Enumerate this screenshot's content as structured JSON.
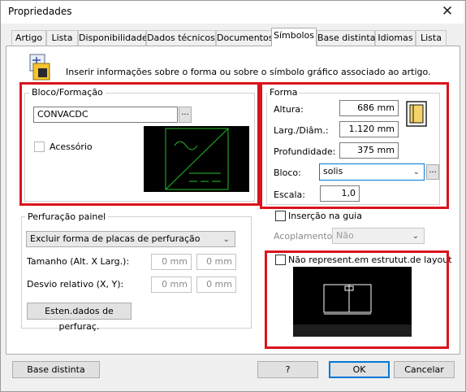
{
  "window": {
    "title": "Propriedades"
  },
  "tabs": [
    {
      "label": "Artigo"
    },
    {
      "label": "Lista"
    },
    {
      "label": "Disponibilidade"
    },
    {
      "label": "Dados técnicos"
    },
    {
      "label": "Documentos"
    },
    {
      "label": "Símbolos"
    },
    {
      "label": "Base distinta"
    },
    {
      "label": "Idiomas"
    },
    {
      "label": "Lista"
    }
  ],
  "active_tab": "Símbolos",
  "info_text": "Inserir informações sobre o forma ou sobre o símbolo gráfico associado ao artigo.",
  "bloco": {
    "legend": "Bloco/Formação",
    "value": "CONVACDC",
    "browse_label": "...",
    "acessorio_label": "Acessório",
    "acessorio_checked": false
  },
  "perfuracao": {
    "legend": "Perfuração painel",
    "select_value": "Excluir forma de placas de perfuração",
    "tamanho_label": "Tamanho (Alt. X Larg.):",
    "tamanho_values": [
      "0 mm",
      "0 mm"
    ],
    "desvio_label": "Desvio relativo (X, Y):",
    "desvio_values": [
      "0 mm",
      "0 mm"
    ],
    "button_label": "Esten.dados de perfuraç."
  },
  "forma": {
    "legend": "Forma",
    "altura_label": "Altura:",
    "altura_value": "686 mm",
    "larg_label": "Larg./Diâm.:",
    "larg_value": "1.120 mm",
    "prof_label": "Profundidade:",
    "prof_value": "375 mm",
    "bloco_label": "Bloco:",
    "bloco_value": "solis",
    "escala_label": "Escala:",
    "escala_value": "1,0"
  },
  "insercao_label": "Inserção na guia",
  "acoplamentos_label": "Acoplamentos:",
  "acoplamentos_value": "Não",
  "nao_represent_label": "Não represent.em estrutut.de layout",
  "buttons": {
    "base_distinta": "Base distinta",
    "help": "?",
    "ok": "OK",
    "cancel": "Cancelar"
  },
  "colors": {
    "highlight": "#d9141c",
    "preview_bg": "#000000",
    "preview_stroke": "#22c02a",
    "default_button": "#0078d7"
  }
}
